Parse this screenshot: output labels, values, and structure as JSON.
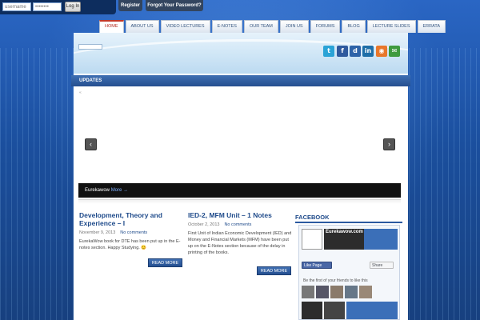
{
  "login": {
    "username_placeholder": "username",
    "password_placeholder": "••••••••",
    "login_label": "Log In",
    "register_label": "Register",
    "forgot_label": "Forgot Your Password?"
  },
  "nav": {
    "items": [
      "HOME",
      "ABOUT US",
      "VIDEO LECTURES",
      "E-NOTES",
      "OUR TEAM",
      "JOIN US",
      "FORUMS",
      "BLOG",
      "LECTURE SLIDES",
      "ERRATA"
    ]
  },
  "social": {
    "icons": [
      "twitter-icon",
      "facebook-icon",
      "digg-icon",
      "linkedin-icon",
      "rss-icon",
      "email-icon"
    ],
    "glyphs": [
      "t",
      "f",
      "d",
      "in",
      "◉",
      "✉"
    ],
    "colors": [
      "#2aa3d6",
      "#2f5a9e",
      "#2d63a8",
      "#1e6fa8",
      "#e8772b",
      "#3e9b3e"
    ]
  },
  "updates": {
    "label": "UPDATES"
  },
  "slider": {
    "small_mark": "«",
    "prev_glyph": "‹",
    "next_glyph": "›",
    "caption": "Eurekawow",
    "more": "More →"
  },
  "posts": [
    {
      "title_line1": "Development, Theory and",
      "title_line2": "Experience – I",
      "date": "November 9, 2013",
      "comments": "No comments",
      "body": "EurekaWow book for DTE has been put up in the E-notes section. Happy Studying. 😊",
      "read_more": "READ MORE"
    },
    {
      "title_line1": "IED-2, MFM Unit – 1 Notes",
      "title_line2": "",
      "date": "October 2, 2013",
      "comments": "No comments",
      "body": "First Unit of Indian Economic Development (IED) and Money and Financial Markets (MFM) have been put up on the E-Notes section because of the delay in printing of the books.",
      "read_more": "READ MORE"
    }
  ],
  "facebook": {
    "heading": "FACEBOOK",
    "page_name": "Eurekawow.com",
    "like_label": "Like Page",
    "share_label": "Share",
    "friends_text": "Be the first of your friends to like this"
  }
}
